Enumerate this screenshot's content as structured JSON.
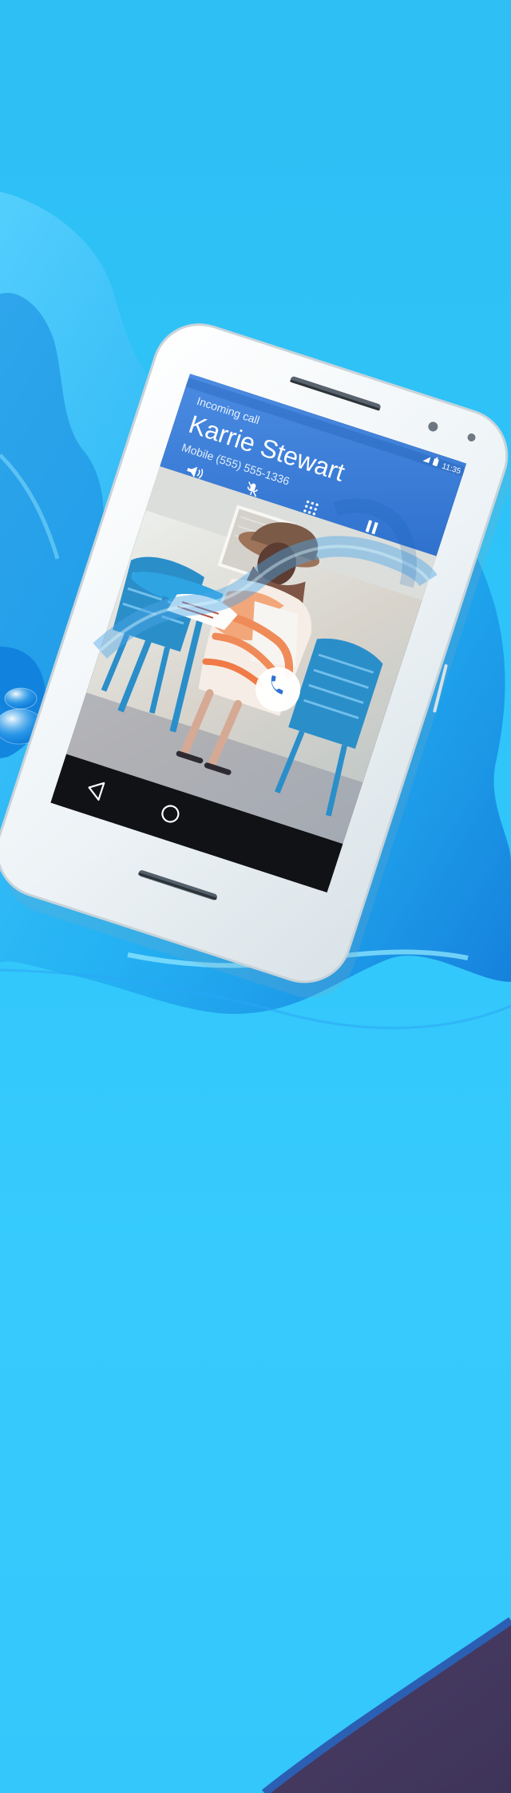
{
  "phone_ui": {
    "status_time": "11:35",
    "incoming_label": "Incoming call",
    "caller_name": "Karrie Stewart",
    "caller_number": "Mobile (555) 555-1336"
  },
  "icons": {
    "speaker": "speaker-icon",
    "mute": "mute-icon",
    "dialpad": "dialpad-icon",
    "hold": "hold-icon",
    "answer": "phone-answer-icon",
    "back": "back-icon",
    "home": "home-icon"
  },
  "colors": {
    "background": "#2ec6fb",
    "accent_header": "#2f73cf",
    "phone_body": "#f1f5f7",
    "corner_purple": "#4b3b63"
  }
}
